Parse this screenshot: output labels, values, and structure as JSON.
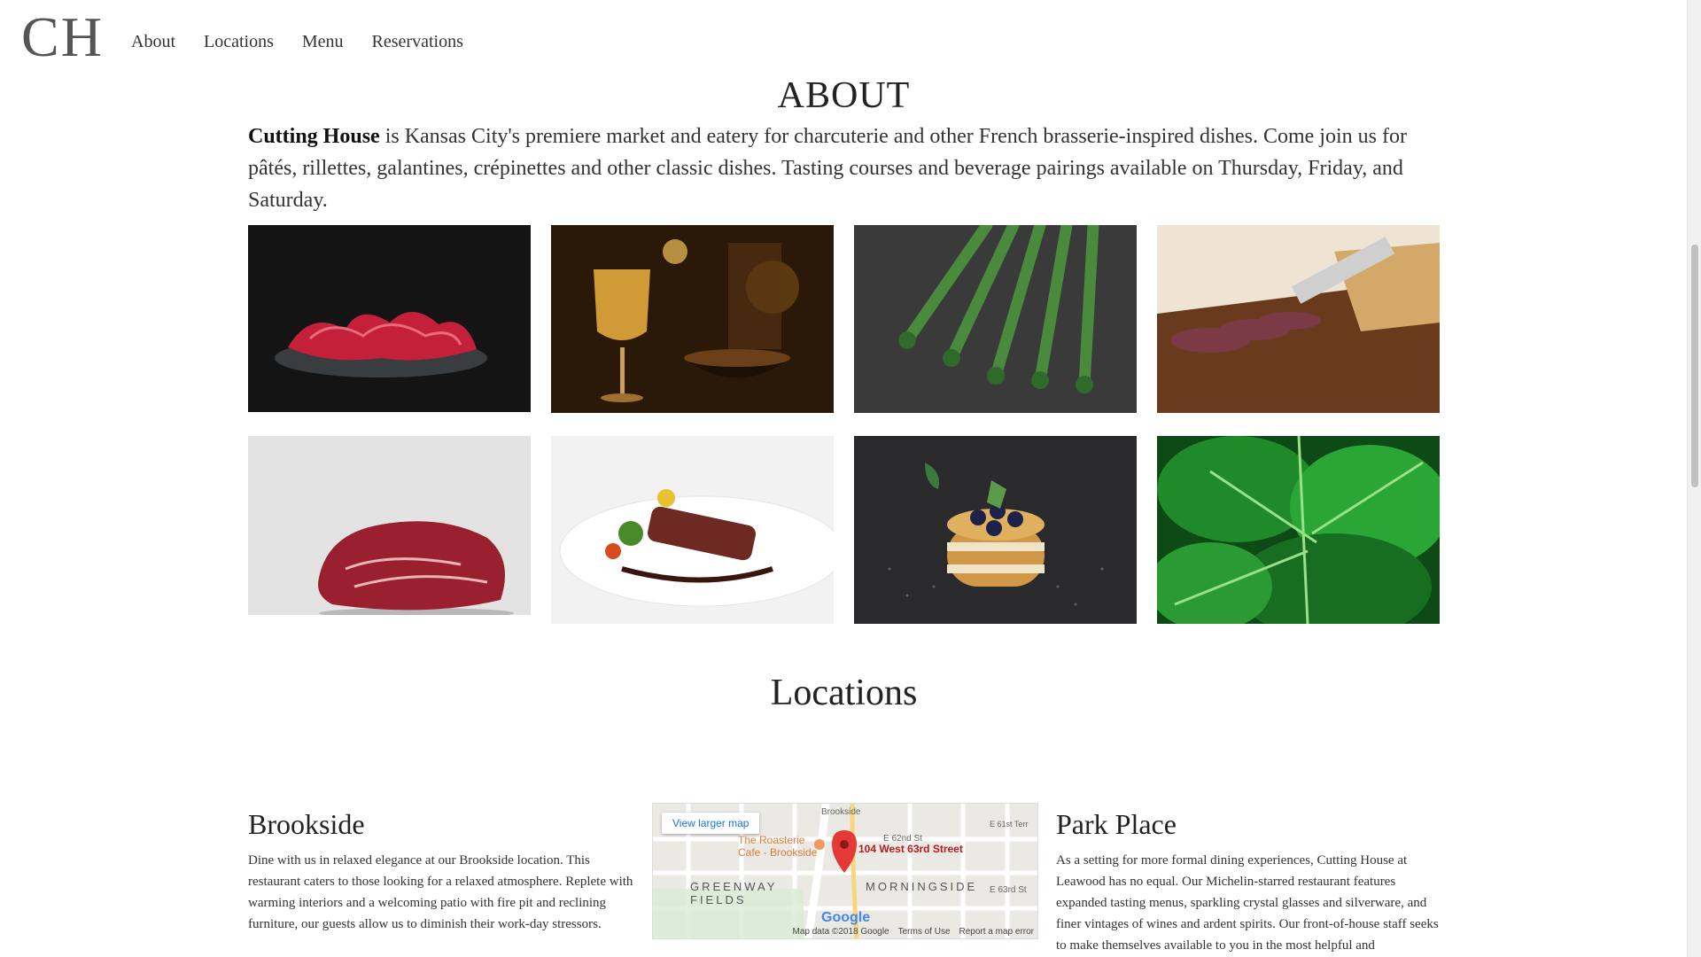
{
  "header": {
    "logo": "CH",
    "nav": [
      "About",
      "Locations",
      "Menu",
      "Reservations"
    ]
  },
  "about": {
    "title": "ABOUT",
    "brand": "Cutting House",
    "text": " is Kansas City's premiere market and eatery for charcuterie and other French brasserie-inspired dishes. Come join us for pâtés, rillettes, galantines, crépinettes and other classic dishes. Tasting courses and beverage pairings available on Thursday, Friday, and Saturday."
  },
  "gallery": [
    {
      "icon": "sliced-ham-image"
    },
    {
      "icon": "white-wine-image"
    },
    {
      "icon": "asparagus-image"
    },
    {
      "icon": "charcuterie-board-image"
    },
    {
      "icon": "raw-beef-image"
    },
    {
      "icon": "plated-steak-image"
    },
    {
      "icon": "blueberry-pancake-image"
    },
    {
      "icon": "green-leaves-image"
    }
  ],
  "locations": {
    "title": "Locations",
    "brookside": {
      "name": "Brookside",
      "text": "Dine with us in relaxed elegance at our Brookside location. This restaurant caters to those looking for a relaxed atmosphere. Replete with warming interiors and a welcoming patio with fire pit and reclining furniture, our guests allow us to diminish their work-day stressors."
    },
    "parkplace": {
      "name": "Park Place",
      "text": "As a setting for more formal dining experiences, Cutting House at Leawood has no equal. Our Michelin-starred restaurant features expanded tasting menus, sparkling crystal glasses and silverware, and finer vintages of wines and ardent spirits. Our front-of-house staff seeks to make themselves available to you in the most helpful and"
    },
    "map": {
      "view_larger": "View larger map",
      "poi": "The Roasterie Cafe - Brookside",
      "pin_label": "104 West 63rd Street",
      "area1": "GREENWAY FIELDS",
      "area2": "MORNINGSIDE",
      "street1": "E 62nd St",
      "street2": "E 63rd St",
      "street3": "E 61st Terr",
      "street4": "Brookside",
      "google": "Google",
      "footer": [
        "Map data ©2018 Google",
        "Terms of Use",
        "Report a map error"
      ]
    }
  },
  "colors": {
    "accent": "#1a73e8",
    "pin": "#e53935"
  }
}
